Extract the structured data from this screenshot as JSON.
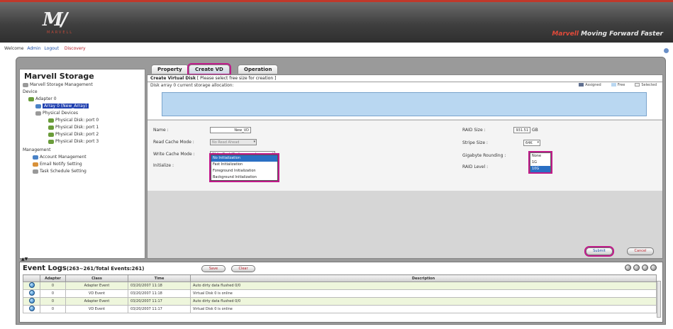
{
  "header": {
    "logo_mark": "M",
    "logo_sub": "MARVELL",
    "tagline_brand": "Marvell",
    "tagline_text": "Moving Forward Faster"
  },
  "welcome": {
    "prefix": "Welcome",
    "user": "Admin",
    "logout": "Logout",
    "discovery": "Discovery"
  },
  "sidebar": {
    "title": "Marvell Storage",
    "items": [
      {
        "label": "Marvell Storage Management"
      },
      {
        "label": "Device"
      },
      {
        "label": "Adapter 0"
      },
      {
        "label": "Array 0 (New_Array)"
      },
      {
        "label": "Physical Devices"
      },
      {
        "label": "Physical Disk: port 0"
      },
      {
        "label": "Physical Disk: port 1"
      },
      {
        "label": "Physical Disk: port 2"
      },
      {
        "label": "Physical Disk: port 3"
      },
      {
        "label": "Management"
      },
      {
        "label": "Account Management"
      },
      {
        "label": "Email Notify Setting"
      },
      {
        "label": "Task Schedule Setting"
      }
    ]
  },
  "tabs": [
    {
      "label": "Property"
    },
    {
      "label": "Create VD"
    },
    {
      "label": "Operation"
    }
  ],
  "panel": {
    "heading_bold": "Create Virtual Disk",
    "heading_rest": "[ Please select free size for creation ]",
    "info": "Disk array 0 current storage allocation:",
    "legend": [
      "Assigned",
      "Free",
      "Selected"
    ]
  },
  "form": {
    "name_label": "Name :",
    "name_value": "New_VD",
    "read_cache_label": "Read Cache Mode :",
    "read_cache_value": "No Read Ahead",
    "write_cache_label": "Write Cache Mode :",
    "write_cache_value": "Write Back(Performance)",
    "initialize_label": "Initialize :",
    "initialize_options": [
      "No Initialization",
      "Fast Initialization",
      "Foreground Initialization",
      "Background Initialization"
    ],
    "raid_size_label": "RAID Size :",
    "raid_size_value": "931.51",
    "raid_size_unit": "GB",
    "stripe_label": "Stripe Size :",
    "stripe_value": "64K",
    "gigabyte_label": "Gigabyte Rounding :",
    "gigabyte_options": [
      "None",
      "1G",
      "10G"
    ],
    "raid_level_label": "RAID Level :"
  },
  "actions": {
    "next": "Submit",
    "cancel": "Cancel"
  },
  "events": {
    "title": "Event Logs",
    "count_text": "(263~261/Total Events:261)",
    "save_btn": "Save",
    "clear_btn": "Clear",
    "columns": [
      "Adapter",
      "Class",
      "Time",
      "Description"
    ],
    "rows": [
      {
        "adapter": "0",
        "class": "Adapter Event",
        "time": "03/20/2007 11:18",
        "description": "Auto dirty data flushed 0/0"
      },
      {
        "adapter": "0",
        "class": "VD Event",
        "time": "03/20/2007 11:18",
        "description": "Virtual Disk 0 is online"
      },
      {
        "adapter": "0",
        "class": "Adapter Event",
        "time": "03/20/2007 11:17",
        "description": "Auto dirty data flushed 0/0"
      },
      {
        "adapter": "0",
        "class": "VD Event",
        "time": "03/20/2007 11:17",
        "description": "Virtual Disk 0 is online"
      }
    ]
  },
  "colors": {
    "accent_red": "#c0392b",
    "highlight": "#c01a8a",
    "selection_blue": "#2a6fc4",
    "capacity_bar": "#b9d7f1"
  }
}
